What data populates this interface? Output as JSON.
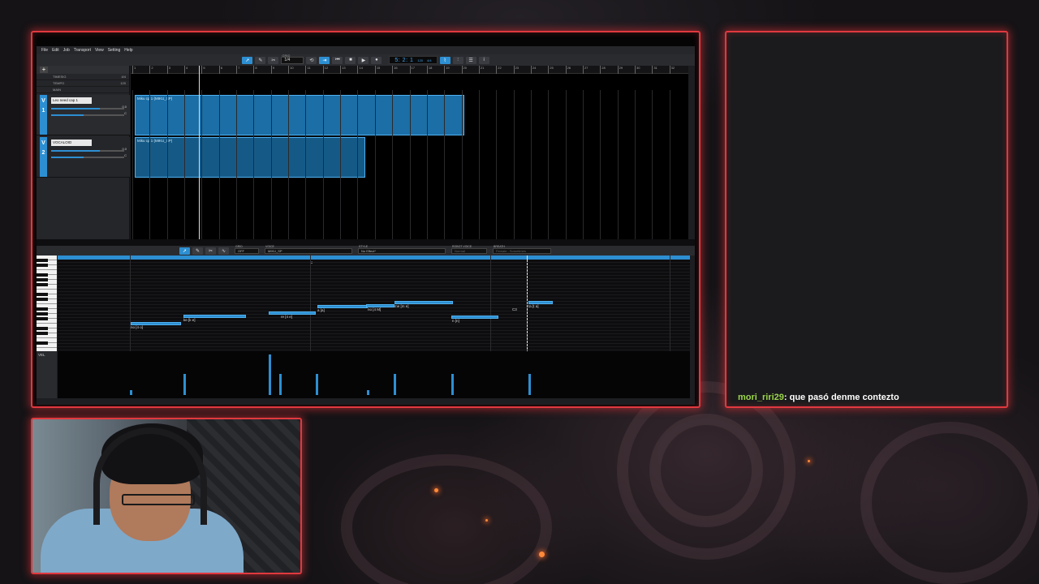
{
  "daw": {
    "menu": [
      "File",
      "Edit",
      "Job",
      "Transport",
      "View",
      "Setting",
      "Help"
    ],
    "toolbar": {
      "grid_label": "GRID",
      "grid_value": "1/4",
      "position": "5: 2: 1",
      "tempo": "120",
      "signature": "4/4"
    },
    "meta_rows": [
      {
        "label": "TIMESIG",
        "value": "4/4"
      },
      {
        "label": "TEMPO",
        "value": "120"
      },
      {
        "label": "MAIN",
        "value": ""
      }
    ],
    "tracks": [
      {
        "num": "1",
        "v": "V",
        "name": "Leo need cap 1",
        "vol": "0.0",
        "pan": "C"
      },
      {
        "num": "2",
        "v": "V",
        "name": "VOCALOID",
        "vol": "0.0",
        "pan": "C"
      }
    ],
    "ruler_numbers": [
      "1",
      "2",
      "3",
      "4",
      "5",
      "6",
      "7",
      "8",
      "9",
      "10",
      "11",
      "12",
      "13",
      "14",
      "15",
      "16",
      "17",
      "18",
      "19",
      "20",
      "21",
      "22",
      "23",
      "24",
      "25",
      "26",
      "27",
      "28",
      "29",
      "30",
      "31",
      "32"
    ],
    "parts": [
      {
        "name": "Miku cp 1 (MIKU_SP)"
      },
      {
        "name": "Miku cp 1 (MIKU_SP)"
      }
    ],
    "editor": {
      "grid_label": "GRID",
      "grid_value": "OFF",
      "voice_label": "VOICE",
      "voice_value": "MIKU_SP",
      "style_label": "STYLE",
      "style_value": "No Effect*",
      "robot_label": "ROBOT VOICE",
      "robot_value": "Normal",
      "breath_label": "BREATH",
      "breath_value": "Female - Sometimes",
      "marker": "8",
      "vel_label": "VEL"
    },
    "notes": [
      {
        "lyric": "no [4 o]"
      },
      {
        "lyric": "ke [k e]"
      },
      {
        "lyric": "re [4 e]"
      },
      {
        "lyric": "a [a]"
      },
      {
        "lyric": "no [4 M]"
      },
      {
        "lyric": "me [m e]"
      },
      {
        "lyric": "n [n]"
      },
      {
        "lyric": "ta [t a]"
      },
      {
        "lyric": "C3"
      }
    ]
  },
  "chat": {
    "user": "mori_riri29",
    "message": "que pasó denme contezto"
  },
  "colors": {
    "frame": "#e0393f",
    "accent": "#2d8fd2",
    "chat_user": "#9bd64a"
  }
}
